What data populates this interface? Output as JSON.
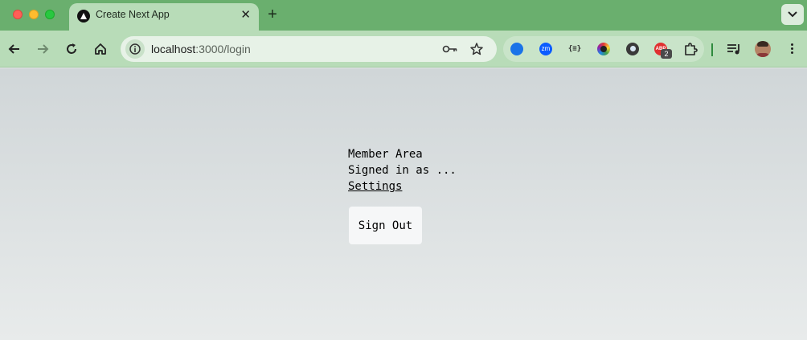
{
  "window": {
    "tab_title": "Create Next App"
  },
  "toolbar": {
    "url_host": "localhost",
    "url_path": ":3000/login",
    "extensions": [
      {
        "name": "scribe-extension-icon",
        "color": "#1a73e8"
      },
      {
        "name": "zoom-extension-icon",
        "color": "#0b5cff",
        "label": "zm"
      },
      {
        "name": "json-formatter-extension-icon",
        "color": "#2a2a2a",
        "label": "{≡}"
      },
      {
        "name": "color-picker-extension-icon",
        "color": "#7b3fe4"
      },
      {
        "name": "eye-dropper-extension-icon",
        "color": "#2a2a2a"
      },
      {
        "name": "adblock-extension-icon",
        "color": "#e03030",
        "label": "ABP"
      }
    ],
    "adblock_badge": "2"
  },
  "page": {
    "member_area": "Member Area",
    "signed_in": "Signed in as ...",
    "settings_link": "Settings",
    "signout_label": "Sign Out"
  }
}
